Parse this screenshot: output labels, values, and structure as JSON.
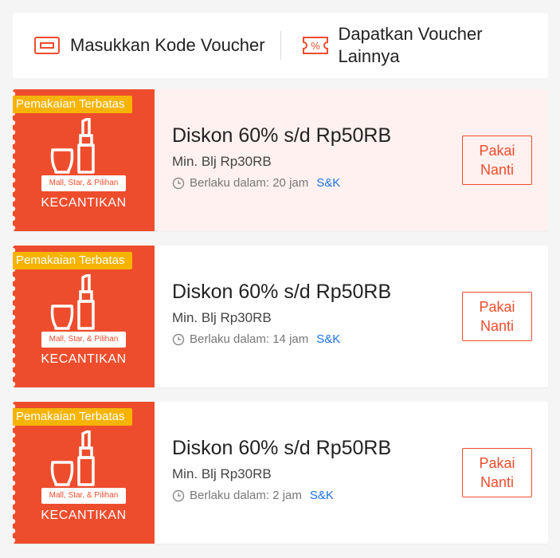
{
  "topbar": {
    "enter_code_label": "Masukkan Kode Voucher",
    "more_vouchers_label": "Dapatkan Voucher Lainnya"
  },
  "vouchers": [
    {
      "badge": "Pemakaian Terbatas",
      "mall_tag": "Mall, Star, & Pilihan",
      "category": "KECANTIKAN",
      "title": "Diskon 60% s/d Rp50RB",
      "min_spend": "Min. Blj Rp30RB",
      "expiry": "Berlaku dalam: 20 jam",
      "tnc": "S&K",
      "button": "Pakai Nanti",
      "highlighted": true
    },
    {
      "badge": "Pemakaian Terbatas",
      "mall_tag": "Mall, Star, & Pilihan",
      "category": "KECANTIKAN",
      "title": "Diskon 60% s/d Rp50RB",
      "min_spend": "Min. Blj Rp30RB",
      "expiry": "Berlaku dalam: 14 jam",
      "tnc": "S&K",
      "button": "Pakai Nanti",
      "highlighted": false
    },
    {
      "badge": "Pemakaian Terbatas",
      "mall_tag": "Mall, Star, & Pilihan",
      "category": "KECANTIKAN",
      "title": "Diskon 60% s/d Rp50RB",
      "min_spend": "Min. Blj Rp30RB",
      "expiry": "Berlaku dalam: 2 jam",
      "tnc": "S&K",
      "button": "Pakai Nanti",
      "highlighted": false
    }
  ],
  "colors": {
    "brand": "#ee4d2d",
    "badge": "#f6b400",
    "highlight_bg": "#fff1ef",
    "link": "#1a73e8"
  }
}
